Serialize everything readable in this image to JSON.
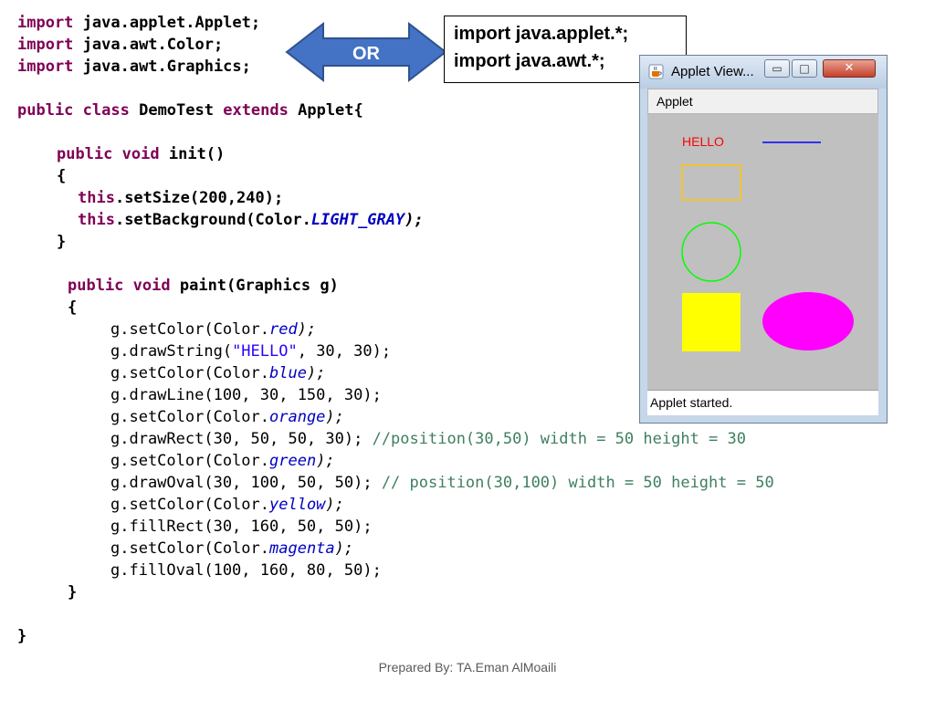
{
  "code": {
    "imports": [
      {
        "kw": "import",
        "rest": " java.applet.Applet;"
      },
      {
        "kw": "import",
        "rest": " java.awt.Color;"
      },
      {
        "kw": "import",
        "rest": " java.awt.Graphics;"
      }
    ],
    "class_decl": {
      "kw1": "public",
      "kw2": "class",
      "name": " DemoTest ",
      "kw3": "extends",
      "rest": " Applet{"
    },
    "init_sig": {
      "kw1": "public",
      "kw2": "void",
      "rest": " init()"
    },
    "open_brace": "{",
    "close_brace": "}",
    "init_body": [
      {
        "kw": "this",
        "plain": ".setSize(200,240);",
        "field": "",
        "tail": ""
      },
      {
        "kw": "this",
        "plain": ".setBackground(Color.",
        "field": "LIGHT_GRAY",
        "tail": ");"
      }
    ],
    "paint_sig": {
      "kw1": "public",
      "kw2": "void",
      "rest": " paint(Graphics g)"
    },
    "paint_body": [
      {
        "pre": "g.setColor(Color.",
        "field": "red",
        "post": ");",
        "comment": ""
      },
      {
        "pre": "g.drawString(",
        "str": "\"HELLO\"",
        "post": ", 30, 30);",
        "comment": ""
      },
      {
        "pre": "g.setColor(Color.",
        "field": "blue",
        "post": ");",
        "comment": ""
      },
      {
        "pre": "g.drawLine(100, 30, 150, 30);",
        "comment": ""
      },
      {
        "pre": "g.setColor(Color.",
        "field": "orange",
        "post": ");",
        "comment": ""
      },
      {
        "pre": "g.drawRect(30, 50, 50, 30); ",
        "comment": "//position(30,50) width = 50 height = 30"
      },
      {
        "pre": "g.setColor(Color.",
        "field": "green",
        "post": ");",
        "comment": ""
      },
      {
        "pre": "g.drawOval(30, 100, 50, 50); ",
        "comment": "// position(30,100) width = 50 height = 50"
      },
      {
        "pre": "g.setColor(Color.",
        "field": "yellow",
        "post": ");",
        "comment": ""
      },
      {
        "pre": "g.fillRect(30, 160, 50, 50);",
        "comment": ""
      },
      {
        "pre": "g.setColor(Color.",
        "field": "magenta",
        "post": ");",
        "comment": ""
      },
      {
        "pre": "g.fillOval(100, 160, 80, 50);",
        "comment": ""
      }
    ]
  },
  "or_arrow": {
    "label": "OR",
    "color": "#4472c4"
  },
  "import_box": {
    "line1": "import java.applet.*;",
    "line2": "import java.awt.*;"
  },
  "applet_window": {
    "title": "Applet View...",
    "menu": "Applet",
    "status": "Applet started.",
    "buttons": {
      "minimize": "▭",
      "maximize": "□",
      "close": "✕"
    },
    "canvas": {
      "text": "HELLO",
      "background": "#c0c0c0"
    }
  },
  "footer": "Prepared By: TA.Eman AlMoaili"
}
